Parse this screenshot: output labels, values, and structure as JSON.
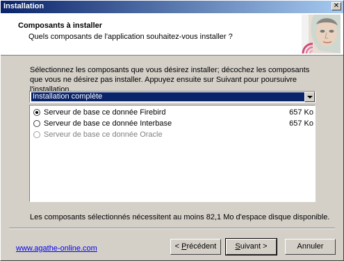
{
  "window": {
    "title": "Installation"
  },
  "header": {
    "title": "Composants à installer",
    "subtitle": "Quels composants de l'application souhaitez-vous installer ?"
  },
  "description": "Sélectionnez les composants que vous désirez installer; décochez les composants que vous ne désirez pas installer. Appuyez ensuite sur Suivant pour poursuivre l'installation.",
  "setup_type": {
    "selected": "Installation complète"
  },
  "components": [
    {
      "name": "Serveur de base ce donnée Firebird",
      "size": "657 Ko",
      "checked": true,
      "enabled": true
    },
    {
      "name": "Serveur de base ce donnée Interbase",
      "size": "657 Ko",
      "checked": false,
      "enabled": true
    },
    {
      "name": "Serveur de base ce donnée Oracle",
      "size": "",
      "checked": false,
      "enabled": false
    }
  ],
  "disk_space": "Les composants sélectionnés nécessitent au moins 82,1 Mo d'espace disque disponible.",
  "footer": {
    "link": "www.agathe-online.com",
    "prev_pre": "< ",
    "prev_u": "P",
    "prev_post": "récédent",
    "next_u": "S",
    "next_post": "uivant >",
    "cancel": "Annuler"
  },
  "icons": {
    "close": "close-icon",
    "header_image": "face-logo-icon",
    "dropdown": "chevron-down-icon"
  }
}
